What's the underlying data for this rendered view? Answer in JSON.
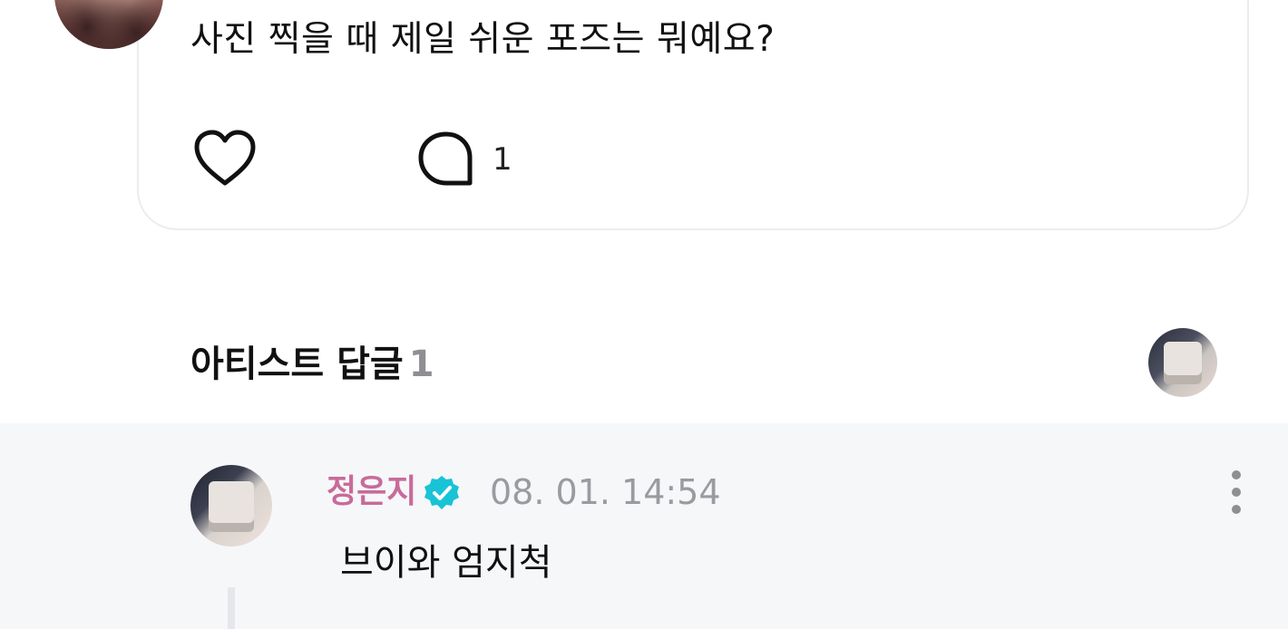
{
  "post": {
    "text": "사진 찍을 때 제일 쉬운 포즈는 뭐예요?",
    "comment_count": "1",
    "like_icon": "heart-outline-icon",
    "comment_icon": "speech-bubble-icon"
  },
  "artist_replies": {
    "title": "아티스트 답글",
    "count": "1"
  },
  "reply": {
    "author": "정은지",
    "timestamp": "08. 01. 14:54",
    "text": "브이와 엄지척",
    "verified_icon": "verified-badge-icon",
    "more_icon": "more-vertical-icon"
  },
  "colors": {
    "author_name": "#c86b9a",
    "verified": "#19c3d6",
    "muted_text": "#9a9aa0",
    "reply_bg": "#f6f7f9",
    "card_border": "#ececf0"
  }
}
